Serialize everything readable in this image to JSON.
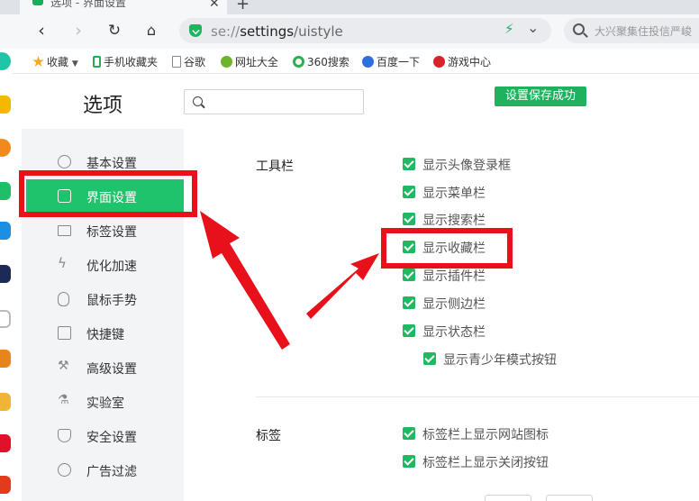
{
  "browser": {
    "tab_title": "选项 - 界面设置",
    "url_scheme": "se://",
    "url_host": "settings",
    "url_path": "/uistyle",
    "search_placeholder": "大兴聚集住投信严峻",
    "icons": {
      "back": "back-arrow-icon",
      "forward": "forward-arrow-icon",
      "reload": "reload-icon",
      "home": "home-icon"
    },
    "colors": {
      "accent": "#1ab55c"
    }
  },
  "bookmarks": [
    {
      "label": "收藏",
      "icon": "star-icon"
    },
    {
      "label": "手机收藏夹",
      "icon": "phone-icon"
    },
    {
      "label": "谷歌",
      "icon": "page-icon"
    },
    {
      "label": "网址大全",
      "icon": "globe-icon"
    },
    {
      "label": "360搜索",
      "icon": "search-360-icon"
    },
    {
      "label": "百度一下",
      "icon": "baidu-paw-icon"
    },
    {
      "label": "游戏中心",
      "icon": "game-icon"
    }
  ],
  "settings": {
    "title": "选项",
    "toast": "设置保存成功",
    "nav": [
      {
        "label": "基本设置",
        "icon": "gear-icon"
      },
      {
        "label": "界面设置",
        "icon": "window-icon",
        "active": true
      },
      {
        "label": "标签设置",
        "icon": "tab-icon"
      },
      {
        "label": "优化加速",
        "icon": "lightning-icon"
      },
      {
        "label": "鼠标手势",
        "icon": "mouse-icon"
      },
      {
        "label": "快捷键",
        "icon": "keyboard-icon"
      },
      {
        "label": "高级设置",
        "icon": "wrench-icon"
      },
      {
        "label": "实验室",
        "icon": "flask-icon"
      },
      {
        "label": "安全设置",
        "icon": "shield-icon"
      },
      {
        "label": "广告过滤",
        "icon": "block-icon"
      }
    ],
    "sections": [
      {
        "label": "工具栏",
        "options": [
          {
            "label": "显示头像登录框",
            "checked": true
          },
          {
            "label": "显示菜单栏",
            "checked": true
          },
          {
            "label": "显示搜索栏",
            "checked": true
          },
          {
            "label": "显示收藏栏",
            "checked": true
          },
          {
            "label": "显示插件栏",
            "checked": true
          },
          {
            "label": "显示侧边栏",
            "checked": true
          },
          {
            "label": "显示状态栏",
            "checked": true
          },
          {
            "label": "显示青少年模式按钮",
            "checked": true
          }
        ]
      },
      {
        "label": "标签",
        "options": [
          {
            "label": "标签栏上显示网站图标",
            "checked": true
          },
          {
            "label": "标签栏上显示关闭按钮",
            "checked": true
          }
        ]
      }
    ],
    "colors": {
      "active_nav": "#1fc36b",
      "checkbox": "#22b861",
      "annotation": "#e8101a"
    }
  }
}
